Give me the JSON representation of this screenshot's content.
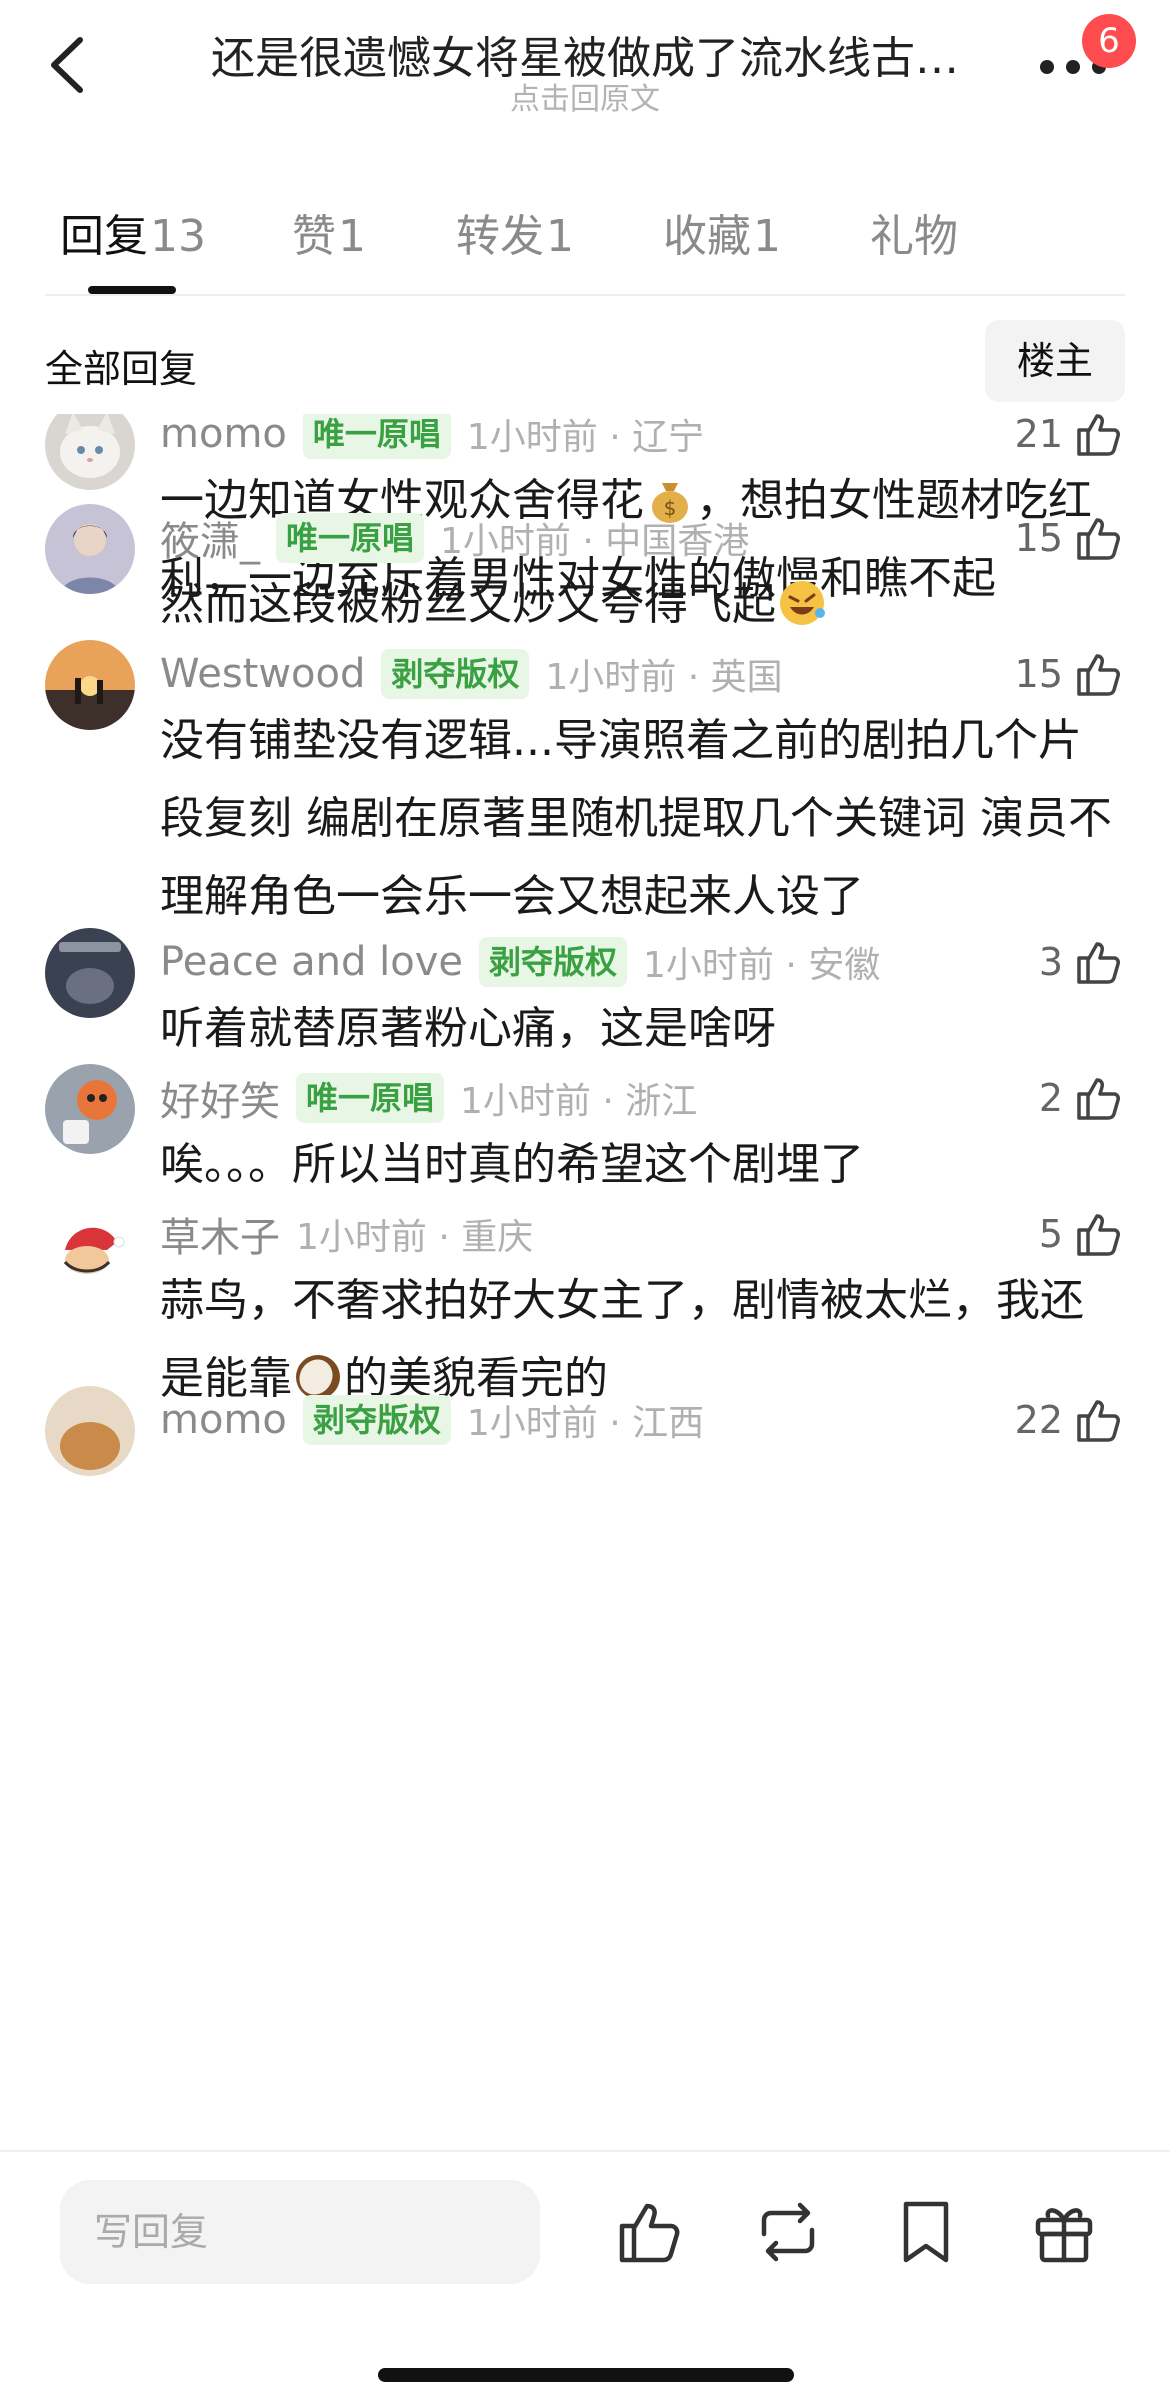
{
  "header": {
    "title": "还是很遗憾女将星被做成了流水线古…",
    "subtitle": "点击回原文",
    "badge_count": "6",
    "back_icon": "chevron-left-icon",
    "more_icon": "more-dots-icon"
  },
  "tabs": [
    {
      "label": "回复",
      "count": "13",
      "active": true
    },
    {
      "label": "赞",
      "count": "1"
    },
    {
      "label": "转发",
      "count": "1"
    },
    {
      "label": "收藏",
      "count": "1"
    },
    {
      "label": "礼物",
      "count": ""
    }
  ],
  "filter": {
    "title": "全部回复",
    "owner_button": "楼主"
  },
  "comments": [
    {
      "user": "momo",
      "tag": "唯一原唱",
      "time": "1小时前 · 辽宁",
      "likes": "21",
      "text_1": "一边知道女性观众舍得花",
      "text_2": "，想拍女性题材吃红利，一边充斥着男性对女性的傲慢和瞧不起",
      "emoji": "money-bag-emoji"
    },
    {
      "user": "筱潇_",
      "tag": "唯一原唱",
      "time": "1小时前 · 中国香港",
      "likes": "15",
      "text_1": "然而这段被粉丝又炒又夸得飞起",
      "text_2": "",
      "emoji": "rofl-emoji"
    },
    {
      "user": "Westwood",
      "tag": "剥夺版权",
      "time": "1小时前 · 英国",
      "likes": "15",
      "text_1": "没有铺垫没有逻辑...导演照着之前的剧拍几个片段复刻 编剧在原著里随机提取几个关键词 演员不理解角色一会乐一会又想起来人设了",
      "text_2": ""
    },
    {
      "user": "Peace and love",
      "tag": "剥夺版权",
      "time": "1小时前 · 安徽",
      "likes": "3",
      "text_1": "听着就替原著粉心痛，这是啥呀",
      "text_2": ""
    },
    {
      "user": "好好笑",
      "tag": "唯一原唱",
      "time": "1小时前 · 浙江",
      "likes": "2",
      "text_1": "唉。。。所以当时真的希望这个剧埋了",
      "text_2": ""
    },
    {
      "user": "草木子",
      "tag": "",
      "time": "1小时前 · 重庆",
      "likes": "5",
      "text_1": "蒜鸟，不奢求拍好大女主了，剧情被太烂，我还是能靠",
      "text_2": "的美貌看完的",
      "emoji": "coconut-emoji"
    },
    {
      "user": "momo",
      "tag": "剥夺版权",
      "time": "1小时前 · 江西",
      "likes": "22",
      "text_1": "",
      "text_2": ""
    }
  ],
  "bottom_bar": {
    "reply_placeholder": "写回复",
    "icons": [
      "thumbs-up-icon",
      "repost-icon",
      "bookmark-icon",
      "gift-icon"
    ]
  }
}
